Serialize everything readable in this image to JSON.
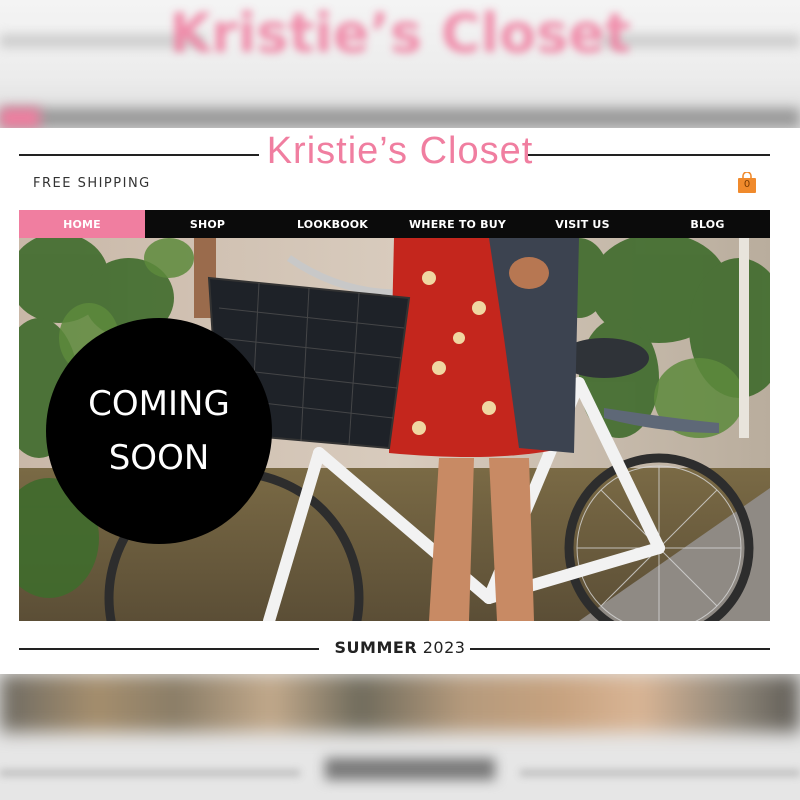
{
  "site": {
    "title": "Kristie’s Closet",
    "accent_color": "#f07ea0",
    "free_shipping": "FREE SHIPPING",
    "cart": {
      "icon": "shopping-bag-icon",
      "count": "0",
      "color": "#f08a2c"
    }
  },
  "nav": {
    "items": [
      {
        "label": "HOME",
        "active": true
      },
      {
        "label": "SHOP",
        "active": false
      },
      {
        "label": "LOOKBOOK",
        "active": false
      },
      {
        "label": "WHERE TO BUY",
        "active": false
      },
      {
        "label": "VISIT US",
        "active": false
      },
      {
        "label": "BLOG",
        "active": false
      }
    ]
  },
  "hero": {
    "badge_line1": "COMING",
    "badge_line2": "SOON"
  },
  "footer": {
    "season": "SUMMER",
    "year": "2023"
  }
}
